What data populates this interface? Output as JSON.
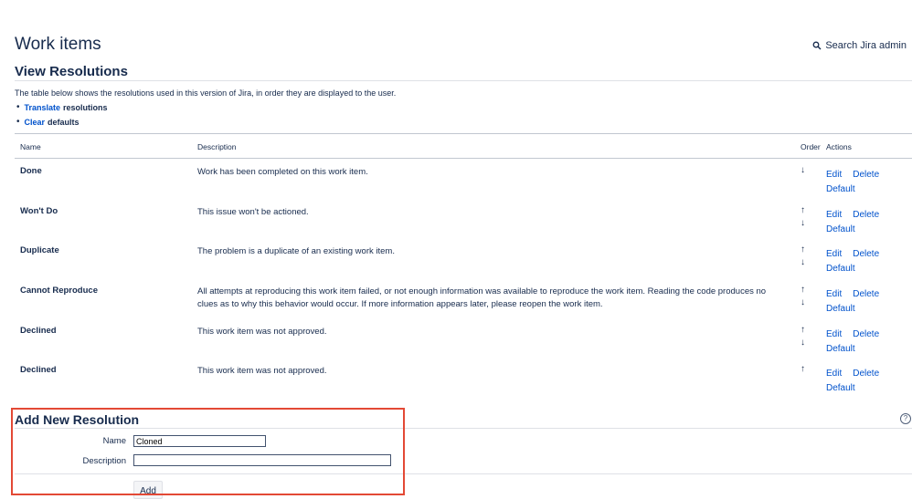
{
  "header": {
    "title": "Work items",
    "search_label": "Search Jira admin"
  },
  "view": {
    "title": "View Resolutions",
    "intro": "The table below shows the resolutions used in this version of Jira, in order they are displayed to the user.",
    "links": [
      {
        "link": "Translate",
        "text": "resolutions"
      },
      {
        "link": "Clear",
        "text": "defaults"
      }
    ]
  },
  "table": {
    "columns": {
      "name": "Name",
      "description": "Description",
      "order": "Order",
      "actions": "Actions"
    },
    "rows": [
      {
        "name": "Done",
        "description": "Work has been completed on this work item.",
        "up": "",
        "down": "↓",
        "edit": "Edit",
        "delete": "Delete",
        "default": "Default"
      },
      {
        "name": "Won't Do",
        "description": "This issue won't be actioned.",
        "up": "↑",
        "down": "↓",
        "edit": "Edit",
        "delete": "Delete",
        "default": "Default"
      },
      {
        "name": "Duplicate",
        "description": "The problem is a duplicate of an existing work item.",
        "up": "↑",
        "down": "↓",
        "edit": "Edit",
        "delete": "Delete",
        "default": "Default"
      },
      {
        "name": "Cannot Reproduce",
        "description": "All attempts at reproducing this work item failed, or not enough information was available to reproduce the work item. Reading the code produces no clues as to why this behavior would occur. If more information appears later, please reopen the work item.",
        "up": "↑",
        "down": "↓",
        "edit": "Edit",
        "delete": "Delete",
        "default": "Default"
      },
      {
        "name": "Declined",
        "description": "This work item was not approved.",
        "up": "↑",
        "down": "↓",
        "edit": "Edit",
        "delete": "Delete",
        "default": "Default"
      },
      {
        "name": "Declined",
        "description": "This work item was not approved.",
        "up": "↑",
        "down": "",
        "edit": "Edit",
        "delete": "Delete",
        "default": "Default"
      }
    ]
  },
  "add_form": {
    "title": "Add New Resolution",
    "help_glyph": "?",
    "name_label": "Name",
    "name_value": "Cloned",
    "description_label": "Description",
    "description_value": "",
    "add_button": "Add"
  }
}
